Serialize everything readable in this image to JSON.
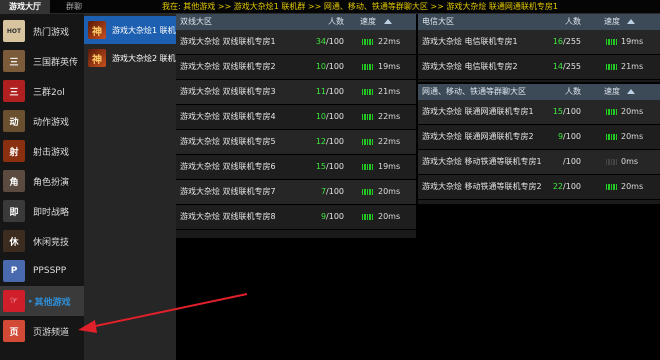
{
  "topbar": {
    "tabs": [
      "游戏大厅",
      "群聊"
    ],
    "breadcrumb": "我在:  其他游戏 >> 游戏大杂烩1 联机群 >> 网通、移动、铁通等群聊大区 >> 游戏大杂烩 联通网通联机专房1"
  },
  "sidebar": {
    "items": [
      {
        "label": "热门游戏",
        "icon": "hot-games-icon",
        "badge": "HOT"
      },
      {
        "label": "三国群英传",
        "icon": "three-kingdoms-icon",
        "badge": "三"
      },
      {
        "label": "三群2ol",
        "icon": "sanqun-2ol-icon",
        "badge": "三"
      },
      {
        "label": "动作游戏",
        "icon": "action-game-icon",
        "badge": "动"
      },
      {
        "label": "射击游戏",
        "icon": "shooter-game-icon",
        "badge": "射"
      },
      {
        "label": "角色扮演",
        "icon": "rpg-icon",
        "badge": "角"
      },
      {
        "label": "即时战略",
        "icon": "rts-icon",
        "badge": "即"
      },
      {
        "label": "休闲竞技",
        "icon": "casual-game-icon",
        "badge": "休"
      },
      {
        "label": "PPSSPP",
        "icon": "ppsspp-icon",
        "badge": "P"
      },
      {
        "label": "其他游戏",
        "icon": "other-games-icon",
        "badge": "☞",
        "selected_marker": "▸"
      },
      {
        "label": "页游频道",
        "icon": "webgame-icon",
        "badge": "页"
      }
    ]
  },
  "subsidebar": {
    "items": [
      {
        "label": "游戏大杂烩1 联机群",
        "icon": "game-mix-icon",
        "badge": "神"
      },
      {
        "label": "游戏大杂烩2 联机群",
        "icon": "game-mix-icon",
        "badge": "神"
      }
    ]
  },
  "panel_left": {
    "title": "双线大区",
    "col_users": "人数",
    "col_speed": "速度",
    "rows": [
      {
        "name": "游戏大杂烩 双线联机专房1",
        "cur": "34",
        "tot": "/100",
        "ping": "22ms",
        "signal": 5
      },
      {
        "name": "游戏大杂烩 双线联机专房2",
        "cur": "10",
        "tot": "/100",
        "ping": "19ms",
        "signal": 5
      },
      {
        "name": "游戏大杂烩 双线联机专房3",
        "cur": "11",
        "tot": "/100",
        "ping": "21ms",
        "signal": 5
      },
      {
        "name": "游戏大杂烩 双线联机专房4",
        "cur": "10",
        "tot": "/100",
        "ping": "22ms",
        "signal": 5
      },
      {
        "name": "游戏大杂烩 双线联机专房5",
        "cur": "12",
        "tot": "/100",
        "ping": "22ms",
        "signal": 5
      },
      {
        "name": "游戏大杂烩 双线联机专房6",
        "cur": "15",
        "tot": "/100",
        "ping": "19ms",
        "signal": 5
      },
      {
        "name": "游戏大杂烩 双线联机专房7",
        "cur": "7",
        "tot": "/100",
        "ping": "20ms",
        "signal": 5
      },
      {
        "name": "游戏大杂烩 双线联机专房8",
        "cur": "9",
        "tot": "/100",
        "ping": "20ms",
        "signal": 5
      }
    ]
  },
  "panel_right_top": {
    "title": "电信大区",
    "col_users": "人数",
    "col_speed": "速度",
    "rows": [
      {
        "name": "游戏大杂烩 电信联机专房1",
        "cur": "16",
        "tot": "/255",
        "ping": "19ms",
        "signal": 5
      },
      {
        "name": "游戏大杂烩 电信联机专房2",
        "cur": "14",
        "tot": "/255",
        "ping": "21ms",
        "signal": 5
      }
    ]
  },
  "panel_right_bottom": {
    "title": "网通、移动、铁通等群聊大区",
    "col_users": "人数",
    "col_speed": "速度",
    "rows": [
      {
        "name": "游戏大杂烩 联通网通联机专房1",
        "cur": "15",
        "tot": "/100",
        "ping": "20ms",
        "signal": 5
      },
      {
        "name": "游戏大杂烩 联通网通联机专房2",
        "cur": "9",
        "tot": "/100",
        "ping": "20ms",
        "signal": 5
      },
      {
        "name": "游戏大杂烩 移动铁通等联机专房1",
        "cur": "",
        "tot": "/100",
        "ping": "0ms",
        "signal": 0
      },
      {
        "name": "游戏大杂烩 移动铁通等联机专房2",
        "cur": "22",
        "tot": "/100",
        "ping": "20ms",
        "signal": 5
      }
    ]
  },
  "colors": {
    "selected_blue": "#1d5fb0",
    "breadcrumb_yellow": "#e3c900",
    "user_count_green": "#3ee83e",
    "signal_green": "#22cc22",
    "annotation_arrow": "#e0202a"
  }
}
